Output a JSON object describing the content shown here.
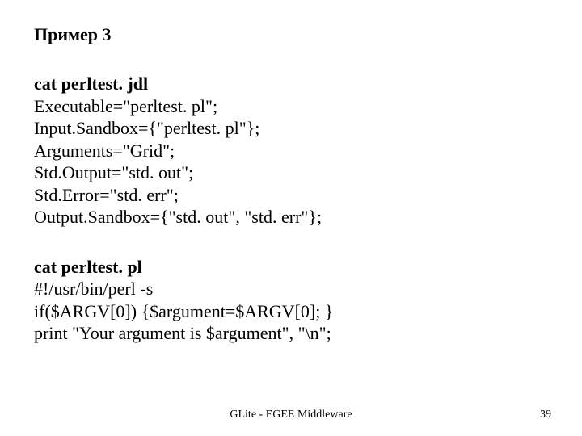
{
  "title": "Пример 3",
  "block1": {
    "heading": "cat perltest. jdl",
    "lines": [
      "Executable=\"perltest. pl\";",
      "Input.Sandbox={\"perltest. pl\"};",
      "Arguments=\"Grid\";",
      "Std.Output=\"std. out\";",
      "Std.Error=\"std. err\";",
      "Output.Sandbox={\"std. out\", \"std. err\"};"
    ]
  },
  "block2": {
    "heading": "cat perltest. pl",
    "lines": [
      "#!/usr/bin/perl -s",
      "if($ARGV[0]) {$argument=$ARGV[0]; }",
      "print \"Your argument is $argument\", \"\\n\";"
    ]
  },
  "footer": "GLite - EGEE Middleware",
  "page": "39"
}
